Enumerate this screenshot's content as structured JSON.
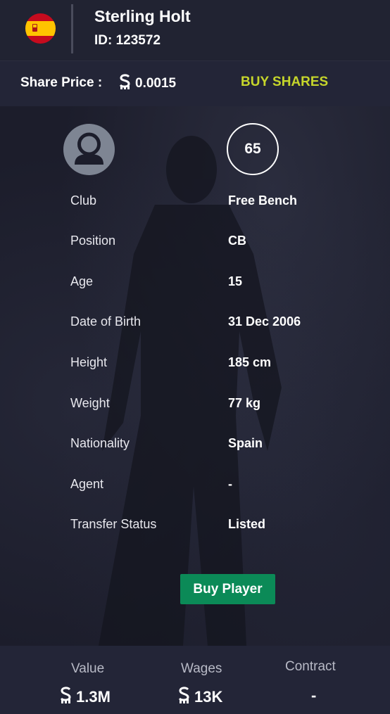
{
  "header": {
    "flag_icon": "spain-flag-icon",
    "player_name": "Sterling Holt",
    "player_id": "ID: 123572"
  },
  "share": {
    "label": "Share Price :",
    "currency_icon": "coin-currency-icon",
    "price": "0.0015",
    "buy_label": "BUY SHARES",
    "buy_color": "#c6d62b"
  },
  "profile": {
    "avatar_icon": "user-avatar-icon",
    "rating": "65"
  },
  "attributes": [
    {
      "label": "Club",
      "value": "Free Bench"
    },
    {
      "label": "Position",
      "value": "CB"
    },
    {
      "label": "Age",
      "value": "15"
    },
    {
      "label": "Date of Birth",
      "value": "31 Dec 2006"
    },
    {
      "label": "Height",
      "value": "185 cm"
    },
    {
      "label": "Weight",
      "value": "77 kg"
    },
    {
      "label": "Nationality",
      "value": "Spain"
    },
    {
      "label": "Agent",
      "value": "-"
    },
    {
      "label": "Transfer Status",
      "value": "Listed"
    }
  ],
  "actions": {
    "buy_player_label": "Buy Player",
    "buy_player_color": "#0b8a57"
  },
  "footer": {
    "value_label": "Value",
    "value": "1.3M",
    "wages_label": "Wages",
    "wages": "13K",
    "contract_label": "Contract",
    "contract": "-"
  }
}
